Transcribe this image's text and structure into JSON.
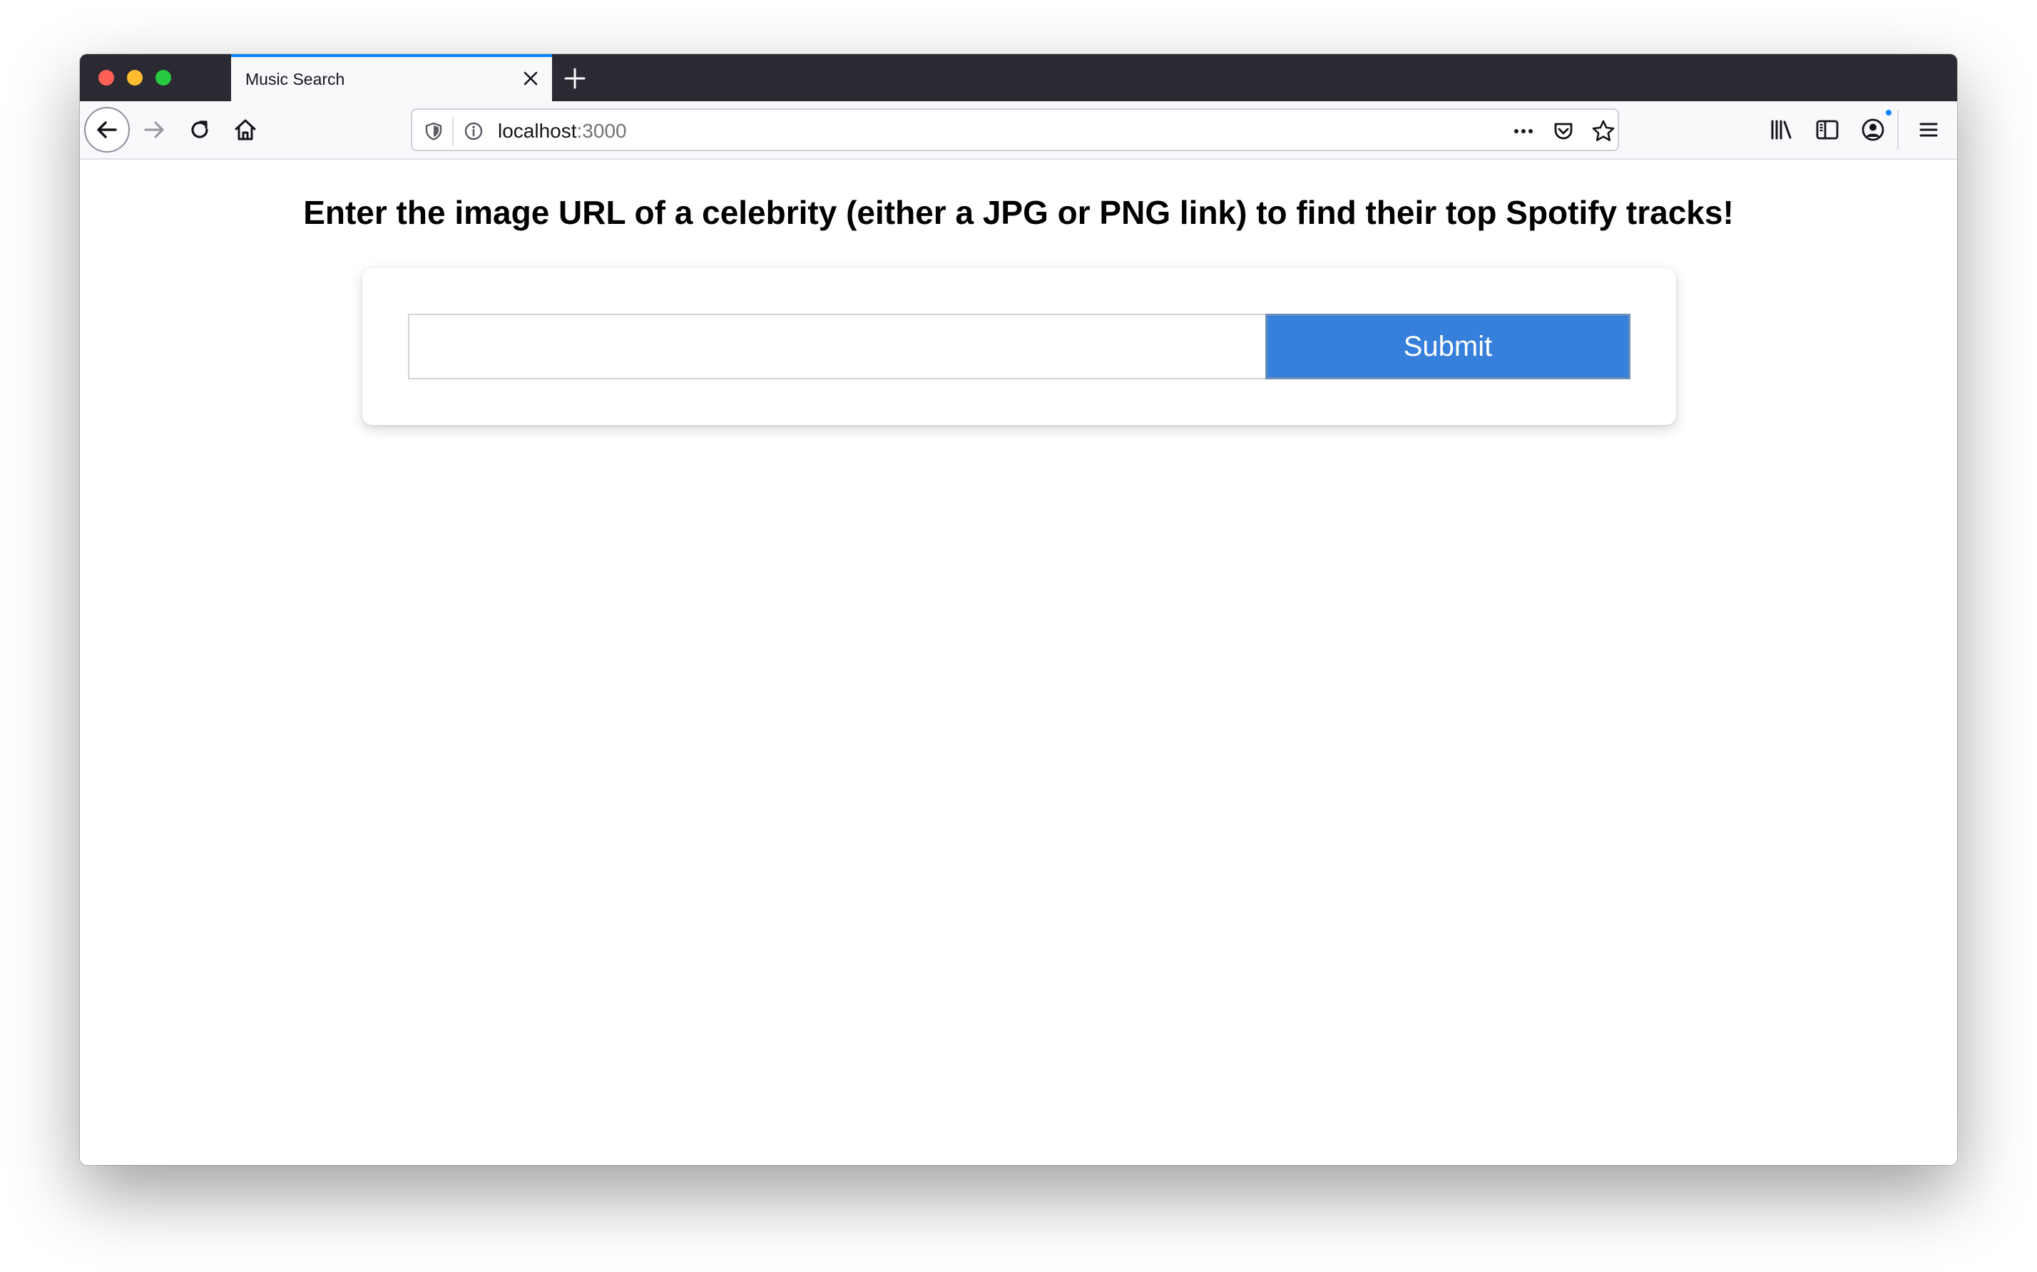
{
  "browser": {
    "tab": {
      "title": "Music Search"
    },
    "url": {
      "host": "localhost",
      "port": ":3000"
    },
    "accent_color": "#0a84ff"
  },
  "page": {
    "heading": "Enter the image URL of a celebrity (either a JPG or PNG link) to find their top Spotify tracks!",
    "input": {
      "value": "",
      "placeholder": ""
    },
    "submit_label": "Submit",
    "submit_color": "#3680dc"
  },
  "icons": {
    "tab": [
      "close-icon",
      "plus-icon"
    ],
    "nav": [
      "back-arrow-icon",
      "forward-arrow-icon",
      "reload-icon",
      "home-icon"
    ],
    "urlbar": [
      "shield-icon",
      "info-icon",
      "more-dots-icon",
      "pocket-icon",
      "star-icon"
    ],
    "toolbar": [
      "library-icon",
      "sidebar-icon",
      "account-icon",
      "menu-icon"
    ]
  }
}
